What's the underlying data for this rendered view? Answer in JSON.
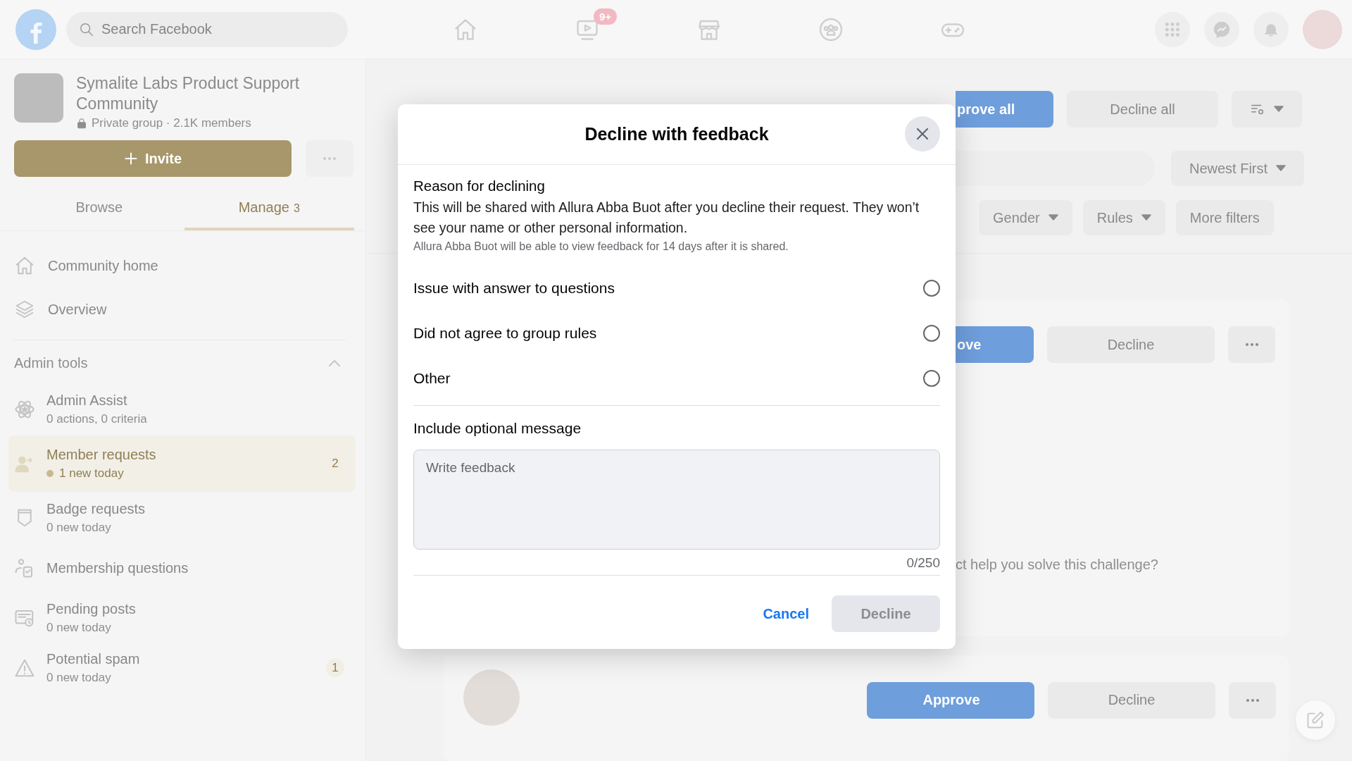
{
  "top_bar": {
    "search": {
      "placeholder": "Search Facebook"
    },
    "nav_items": [
      {
        "kind": "home"
      },
      {
        "kind": "video",
        "badge": "9+"
      },
      {
        "kind": "store"
      },
      {
        "kind": "groups"
      },
      {
        "kind": "gaming"
      }
    ],
    "actions": [
      {
        "kind": "menu"
      },
      {
        "kind": "messenger"
      },
      {
        "kind": "bell"
      },
      {
        "kind": "avatar"
      }
    ]
  },
  "sidebar": {
    "group": {
      "name": "Symalite Labs Product Support Community",
      "meta": "Private group · 2.1K members"
    },
    "invite_button": "Invite",
    "tabs": [
      {
        "label": "Browse",
        "selected": false
      },
      {
        "label": "Manage",
        "count": "3",
        "selected": true
      }
    ],
    "nav": [
      {
        "kind": "home",
        "label": "Community home"
      },
      {
        "kind": "overview",
        "label": "Overview"
      }
    ],
    "admin_tools": {
      "title": "Admin tools",
      "expanded": true,
      "items": [
        {
          "kind": "assist",
          "label": "Admin Assist",
          "subtitle": "0 actions, 0 criteria",
          "selected": false,
          "unread": false
        },
        {
          "kind": "members",
          "label": "Member requests",
          "subtitle": "1 new today",
          "selected": true,
          "unread": true,
          "count": "2"
        },
        {
          "kind": "badge",
          "label": "Badge requests",
          "subtitle": "0 new today",
          "selected": false,
          "unread": false
        },
        {
          "kind": "questions",
          "label": "Membership questions",
          "selected": false
        },
        {
          "kind": "pending",
          "label": "Pending posts",
          "subtitle": "0 new today",
          "selected": false,
          "unread": false
        },
        {
          "kind": "spam",
          "label": "Potential spam",
          "subtitle": "0 new today",
          "selected": false,
          "unread": false,
          "count": "1"
        }
      ]
    }
  },
  "main": {
    "bulk_actions": {
      "approve_all": "prove all",
      "decline_all": "Decline all"
    },
    "sort": "Newest First",
    "filters": [
      "Gender",
      "Rules",
      "More filters"
    ],
    "requests": [
      {
        "approve": "ove",
        "decline": "Decline",
        "question": "ct help you solve this challenge?"
      },
      {
        "approve": "Approve",
        "decline": "Decline"
      }
    ]
  },
  "dialog": {
    "title": "Decline with feedback",
    "reason": {
      "heading": "Reason for declining",
      "description": "This will be shared with Allura Abba Buot after you decline their request. They won’t see your name or other personal information.",
      "note": "Allura Abba Buot will be able to view feedback for 14 days after it is shared."
    },
    "options": [
      {
        "label": "Issue with answer to questions",
        "selected": false
      },
      {
        "label": "Did not agree to group rules",
        "selected": false
      },
      {
        "label": "Other",
        "selected": false
      }
    ],
    "message": {
      "label": "Include optional message",
      "placeholder": "Write feedback",
      "counter": "0/250"
    },
    "buttons": {
      "cancel": "Cancel",
      "decline": "Decline",
      "decline_disabled": true
    }
  }
}
